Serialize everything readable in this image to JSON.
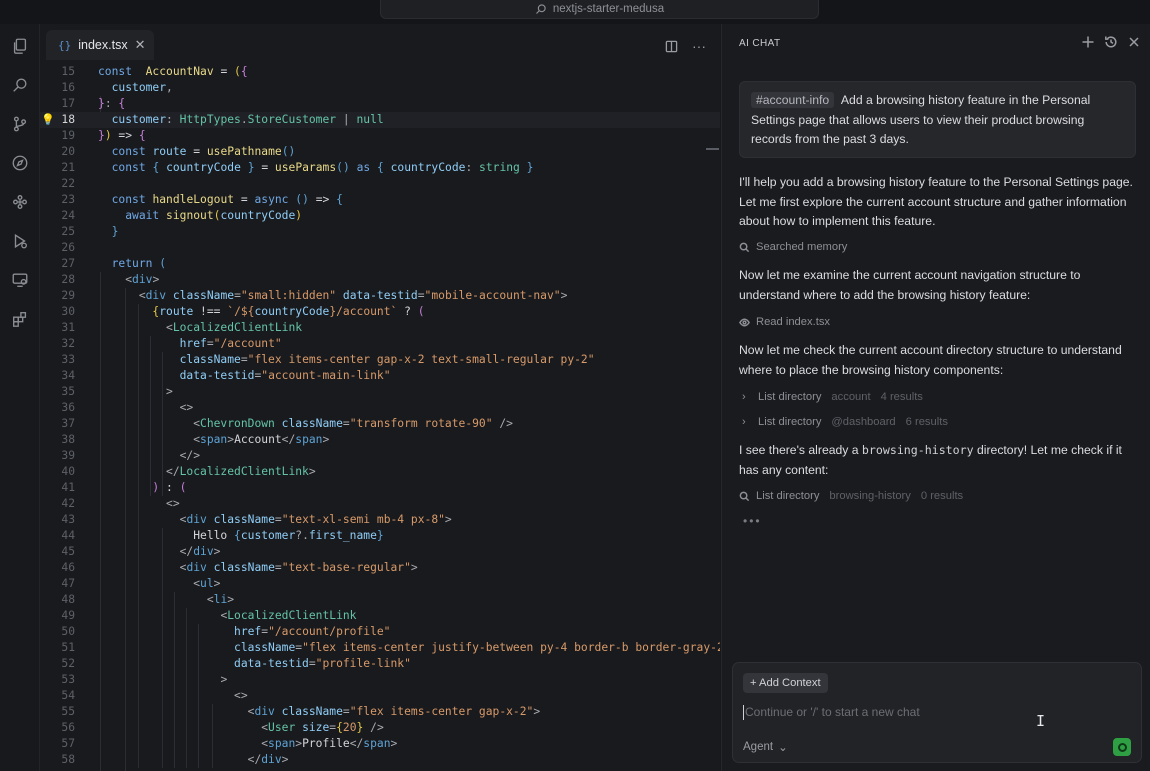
{
  "window": {
    "search_text": "nextjs-starter-medusa"
  },
  "activity_bar": {
    "icons": [
      "files-icon",
      "search-icon",
      "source-control-icon",
      "explore-icon",
      "extensions-cluster-icon",
      "run-debug-icon",
      "remote-icon",
      "extensions-icon"
    ]
  },
  "editor": {
    "tab": {
      "filename": "index.tsx",
      "icon_glyph": "{}",
      "close_glyph": "✕"
    },
    "actions": {
      "more_glyph": "···"
    },
    "active_line": "18"
  },
  "chat": {
    "title": "AI CHAT",
    "user_message": {
      "context_tag": "#account-info",
      "text": "Add a browsing history feature in the Personal Settings page that allows users to view their product browsing records from the past 3 days."
    },
    "msg1": "I'll help you add a browsing history feature to the Personal Settings page. Let me first explore the current account structure and gather information about how to implement this feature.",
    "tool1": {
      "label": "Searched memory"
    },
    "msg2": "Now let me examine the current account navigation structure to understand where to add the browsing history feature:",
    "tool2": {
      "label": "Read index.tsx"
    },
    "msg3": "Now let me check the current account directory structure to understand where to place the browsing history components:",
    "tool3": {
      "label": "List directory",
      "path": "account",
      "count": "4 results"
    },
    "tool4": {
      "label": "List directory",
      "path": "@dashboard",
      "count": "6 results"
    },
    "msg4_pre": "I see there's already a",
    "msg4_code": "browsing-history",
    "msg4_post": "directory! Let me check if it has any content:",
    "tool5": {
      "label": "List directory",
      "path": "browsing-history",
      "count": "0 results"
    },
    "thinking": "•••",
    "input": {
      "add_context": "+ Add Context",
      "placeholder": "Continue or '/' to start a new chat",
      "mode": "Agent",
      "mode_chevron": "⌄"
    }
  },
  "colors": {
    "accent_green": "#2ea043",
    "bulb": "#e5b83a"
  }
}
